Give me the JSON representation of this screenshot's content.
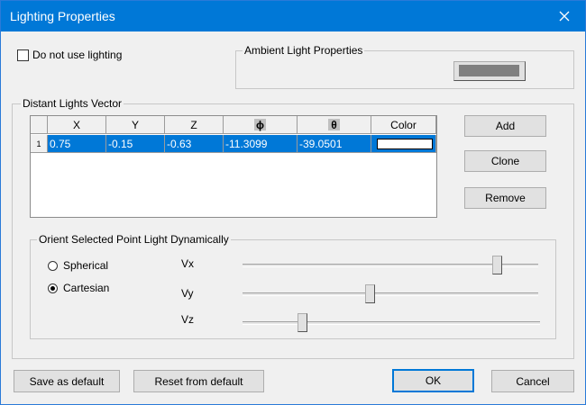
{
  "window": {
    "title": "Lighting Properties",
    "close_icon": "close-icon",
    "accent_color": "#0078d7"
  },
  "no_lighting": {
    "label": "Do not use lighting",
    "checked": false
  },
  "ambient": {
    "title": "Ambient Light Properties",
    "swatch_color": "#808080"
  },
  "distant": {
    "title": "Distant Lights Vector",
    "columns": [
      "X",
      "Y",
      "Z",
      "ϕ",
      "θ",
      "Color"
    ],
    "rows": [
      {
        "index": "1",
        "x": "0.75",
        "y": "-0.15",
        "z": "-0.63",
        "phi": "-11.3099",
        "theta": "-39.0501",
        "color": "#ffffff",
        "selected": true
      }
    ],
    "buttons": {
      "add": "Add",
      "clone": "Clone",
      "remove": "Remove"
    }
  },
  "orient": {
    "title": "Orient Selected Point Light Dynamically",
    "modes": [
      {
        "label": "Spherical",
        "selected": false
      },
      {
        "label": "Cartesian",
        "selected": true
      }
    ],
    "sliders": [
      {
        "label": "Vx",
        "value": 0.86
      },
      {
        "label": "Vy",
        "value": 0.43
      },
      {
        "label": "Vz",
        "value": 0.2
      }
    ]
  },
  "footer": {
    "save_default": "Save as default",
    "reset_default": "Reset from default",
    "ok": "OK",
    "cancel": "Cancel"
  }
}
